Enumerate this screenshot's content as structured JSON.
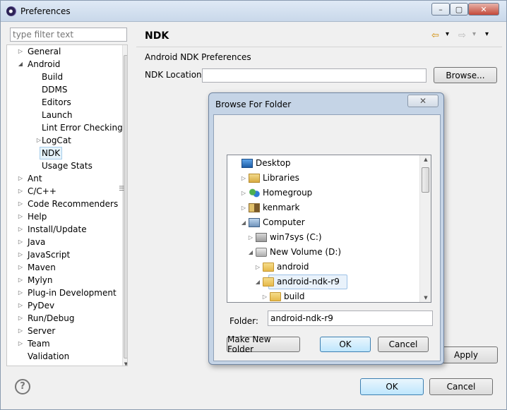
{
  "window": {
    "title": "Preferences",
    "controls": [
      "–",
      "▢",
      "✕"
    ]
  },
  "left": {
    "filter_placeholder": "type filter text",
    "tree": [
      {
        "label": "General",
        "level": 0,
        "toggle": "▷"
      },
      {
        "label": "Android",
        "level": 0,
        "toggle": "◢"
      },
      {
        "label": "Build",
        "level": 1,
        "toggle": ""
      },
      {
        "label": "DDMS",
        "level": 1,
        "toggle": ""
      },
      {
        "label": "Editors",
        "level": 1,
        "toggle": ""
      },
      {
        "label": "Launch",
        "level": 1,
        "toggle": ""
      },
      {
        "label": "Lint Error Checking",
        "level": 1,
        "toggle": ""
      },
      {
        "label": "LogCat",
        "level": 1,
        "toggle": "▷"
      },
      {
        "label": "NDK",
        "level": 1,
        "toggle": "",
        "selected": true
      },
      {
        "label": "Usage Stats",
        "level": 1,
        "toggle": ""
      },
      {
        "label": "Ant",
        "level": 0,
        "toggle": "▷"
      },
      {
        "label": "C/C++",
        "level": 0,
        "toggle": "▷"
      },
      {
        "label": "Code Recommenders",
        "level": 0,
        "toggle": "▷"
      },
      {
        "label": "Help",
        "level": 0,
        "toggle": "▷"
      },
      {
        "label": "Install/Update",
        "level": 0,
        "toggle": "▷"
      },
      {
        "label": "Java",
        "level": 0,
        "toggle": "▷"
      },
      {
        "label": "JavaScript",
        "level": 0,
        "toggle": "▷"
      },
      {
        "label": "Maven",
        "level": 0,
        "toggle": "▷"
      },
      {
        "label": "Mylyn",
        "level": 0,
        "toggle": "▷"
      },
      {
        "label": "Plug-in Development",
        "level": 0,
        "toggle": "▷"
      },
      {
        "label": "PyDev",
        "level": 0,
        "toggle": "▷"
      },
      {
        "label": "Run/Debug",
        "level": 0,
        "toggle": "▷"
      },
      {
        "label": "Server",
        "level": 0,
        "toggle": "▷"
      },
      {
        "label": "Team",
        "level": 0,
        "toggle": "▷"
      },
      {
        "label": "Validation",
        "level": 0,
        "toggle": ""
      }
    ]
  },
  "right": {
    "title": "NDK",
    "section_label": "Android NDK Preferences",
    "ndk_location_label": "NDK Location",
    "ndk_location_value": "",
    "browse_label": "Browse...",
    "apply_label": "Apply",
    "nav_icons": [
      "⇦",
      "▾",
      "⇨",
      "▾",
      "▾"
    ]
  },
  "buttons": {
    "ok": "OK",
    "cancel": "Cancel",
    "help": "?"
  },
  "dialog": {
    "title": "Browse For Folder",
    "close": "✕",
    "tree": [
      {
        "label": "Desktop",
        "indent": 0,
        "toggle": "",
        "icon": "desktop"
      },
      {
        "label": "Libraries",
        "indent": 1,
        "toggle": "▷",
        "icon": "libs"
      },
      {
        "label": "Homegroup",
        "indent": 1,
        "toggle": "▷",
        "icon": "home"
      },
      {
        "label": "kenmark",
        "indent": 1,
        "toggle": "▷",
        "icon": "user"
      },
      {
        "label": "Computer",
        "indent": 1,
        "toggle": "◢",
        "icon": "computer"
      },
      {
        "label": "win7sys (C:)",
        "indent": 2,
        "toggle": "▷",
        "icon": "drive-os"
      },
      {
        "label": "New Volume (D:)",
        "indent": 2,
        "toggle": "◢",
        "icon": "drive"
      },
      {
        "label": "android",
        "indent": 3,
        "toggle": "▷",
        "icon": "folder"
      },
      {
        "label": "android-ndk-r9",
        "indent": 3,
        "toggle": "◢",
        "icon": "folder",
        "selected": true
      },
      {
        "label": "build",
        "indent": 4,
        "toggle": "▷",
        "icon": "folder"
      }
    ],
    "folder_label": "Folder:",
    "folder_value": "android-ndk-r9",
    "make_new_folder": "Make New Folder",
    "ok": "OK",
    "cancel": "Cancel"
  }
}
